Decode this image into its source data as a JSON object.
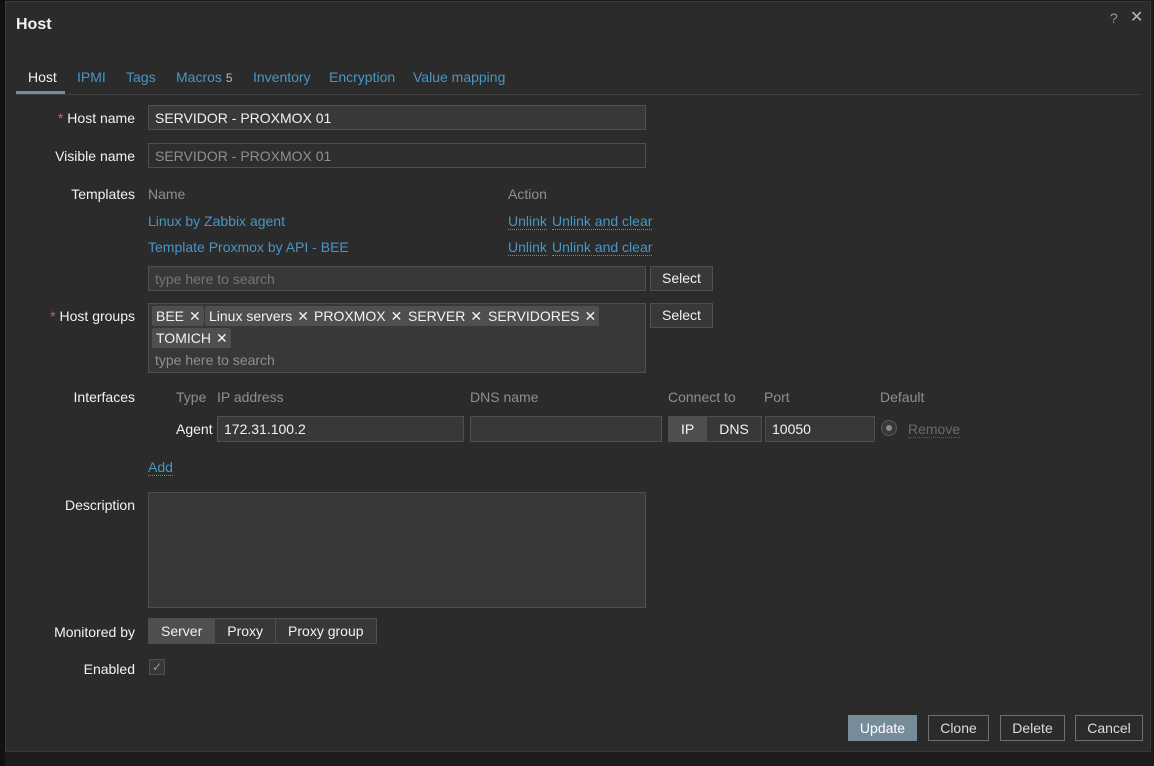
{
  "dialog": {
    "title": "Host",
    "help": "?",
    "close": "✕"
  },
  "tabs": [
    {
      "label": "Host"
    },
    {
      "label": "IPMI"
    },
    {
      "label": "Tags"
    },
    {
      "label": "Macros",
      "count": "5"
    },
    {
      "label": "Inventory"
    },
    {
      "label": "Encryption"
    },
    {
      "label": "Value mapping"
    }
  ],
  "form": {
    "host_name": {
      "label": "Host name",
      "required": "*",
      "value": "SERVIDOR - PROXMOX 01"
    },
    "visible_name": {
      "label": "Visible name",
      "value": "SERVIDOR - PROXMOX 01"
    },
    "templates": {
      "label": "Templates",
      "col_name": "Name",
      "col_action": "Action",
      "rows": [
        {
          "name": "Linux by Zabbix agent",
          "unlink": "Unlink",
          "unlink_clear": "Unlink and clear"
        },
        {
          "name": "Template Proxmox by API - BEE",
          "unlink": "Unlink",
          "unlink_clear": "Unlink and clear"
        }
      ],
      "search_placeholder": "type here to search",
      "select": "Select"
    },
    "host_groups": {
      "label": "Host groups",
      "required": "*",
      "chips": [
        "BEE",
        "Linux servers",
        "PROXMOX",
        "SERVER",
        "SERVIDORES",
        "TOMICH"
      ],
      "search_placeholder": "type here to search",
      "select": "Select"
    },
    "interfaces": {
      "label": "Interfaces",
      "cols": {
        "type": "Type",
        "ip": "IP address",
        "dns": "DNS name",
        "connect": "Connect to",
        "port": "Port",
        "default": "Default"
      },
      "row": {
        "type": "Agent",
        "ip": "172.31.100.2",
        "dns": "",
        "connect_ip": "IP",
        "connect_dns": "DNS",
        "port": "10050",
        "remove": "Remove"
      },
      "add": "Add"
    },
    "description": {
      "label": "Description",
      "value": ""
    },
    "monitored_by": {
      "label": "Monitored by",
      "options": [
        "Server",
        "Proxy",
        "Proxy group"
      ],
      "selected": "Server"
    },
    "enabled": {
      "label": "Enabled",
      "checked": true,
      "mark": "✓"
    }
  },
  "footer": {
    "update": "Update",
    "clone": "Clone",
    "delete": "Delete",
    "cancel": "Cancel"
  }
}
